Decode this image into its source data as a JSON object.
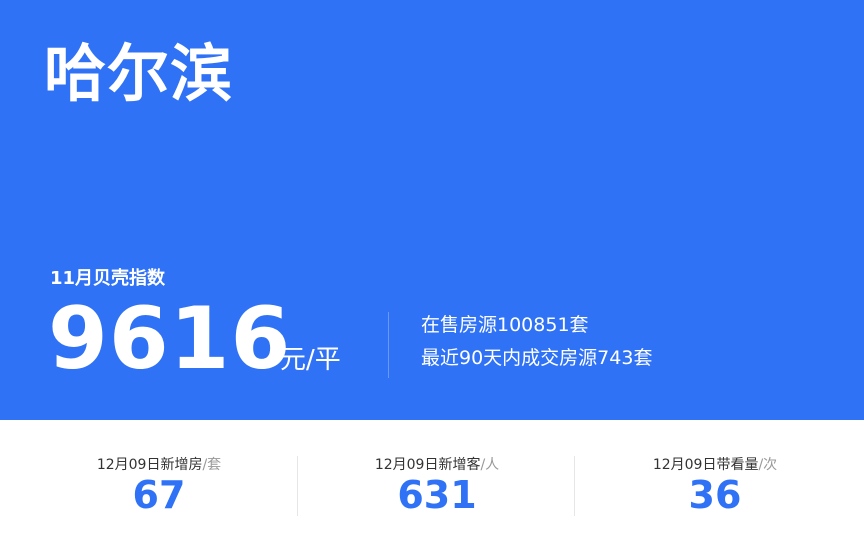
{
  "hero": {
    "city": "哈尔滨",
    "index_label": "11月贝壳指数",
    "price": "9616",
    "price_unit": "元/平",
    "on_sale": "在售房源100851套",
    "recent_deals": "最近90天内成交房源743套"
  },
  "stats": [
    {
      "label": "12月09日新增房",
      "unit": "/套",
      "value": "67"
    },
    {
      "label": "12月09日新增客",
      "unit": "/人",
      "value": "631"
    },
    {
      "label": "12月09日带看量",
      "unit": "/次",
      "value": "36"
    }
  ],
  "colors": {
    "brand_blue": "#2f72f6",
    "white": "#ffffff",
    "label_text": "#333333",
    "unit_gray": "#999999"
  }
}
